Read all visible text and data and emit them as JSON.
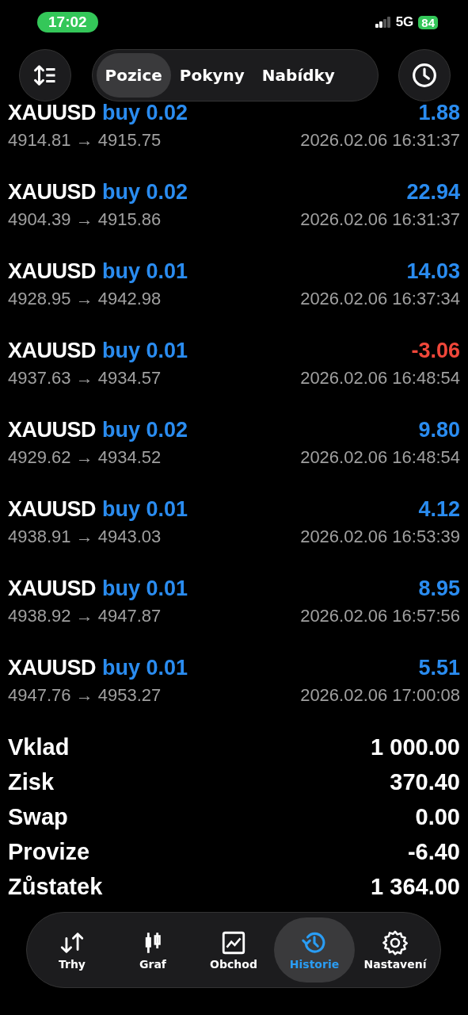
{
  "status_bar": {
    "time": "17:02",
    "network": "5G",
    "battery": "84"
  },
  "tabs": [
    {
      "label": "Pozice",
      "selected": true
    },
    {
      "label": "Pokyny",
      "selected": false
    },
    {
      "label": "Nabídky",
      "selected": false
    }
  ],
  "deals": [
    {
      "symbol": "XAUUSD",
      "trade": "buy 0.02",
      "profit": "1.88",
      "loss": false,
      "prices": "4914.81 → 4915.75",
      "time": "2026.02.06 16:31:37"
    },
    {
      "symbol": "XAUUSD",
      "trade": "buy 0.02",
      "profit": "22.94",
      "loss": false,
      "prices": "4904.39 → 4915.86",
      "time": "2026.02.06 16:31:37"
    },
    {
      "symbol": "XAUUSD",
      "trade": "buy 0.01",
      "profit": "14.03",
      "loss": false,
      "prices": "4928.95 → 4942.98",
      "time": "2026.02.06 16:37:34"
    },
    {
      "symbol": "XAUUSD",
      "trade": "buy 0.01",
      "profit": "-3.06",
      "loss": true,
      "prices": "4937.63 → 4934.57",
      "time": "2026.02.06 16:48:54"
    },
    {
      "symbol": "XAUUSD",
      "trade": "buy 0.02",
      "profit": "9.80",
      "loss": false,
      "prices": "4929.62 → 4934.52",
      "time": "2026.02.06 16:48:54"
    },
    {
      "symbol": "XAUUSD",
      "trade": "buy 0.01",
      "profit": "4.12",
      "loss": false,
      "prices": "4938.91 → 4943.03",
      "time": "2026.02.06 16:53:39"
    },
    {
      "symbol": "XAUUSD",
      "trade": "buy 0.01",
      "profit": "8.95",
      "loss": false,
      "prices": "4938.92 → 4947.87",
      "time": "2026.02.06 16:57:56"
    },
    {
      "symbol": "XAUUSD",
      "trade": "buy 0.01",
      "profit": "5.51",
      "loss": false,
      "prices": "4947.76 → 4953.27",
      "time": "2026.02.06 17:00:08"
    }
  ],
  "summary": [
    {
      "label": "Vklad",
      "value": "1 000.00"
    },
    {
      "label": "Zisk",
      "value": "370.40"
    },
    {
      "label": "Swap",
      "value": "0.00"
    },
    {
      "label": "Provize",
      "value": "-6.40"
    },
    {
      "label": "Zůstatek",
      "value": "1 364.00"
    }
  ],
  "nav": [
    {
      "kind": "markets",
      "label": "Trhy",
      "selected": false
    },
    {
      "kind": "chart",
      "label": "Graf",
      "selected": false
    },
    {
      "kind": "trade",
      "label": "Obchod",
      "selected": false
    },
    {
      "kind": "history",
      "label": "Historie",
      "selected": true
    },
    {
      "kind": "settings",
      "label": "Nastavení",
      "selected": false
    }
  ]
}
